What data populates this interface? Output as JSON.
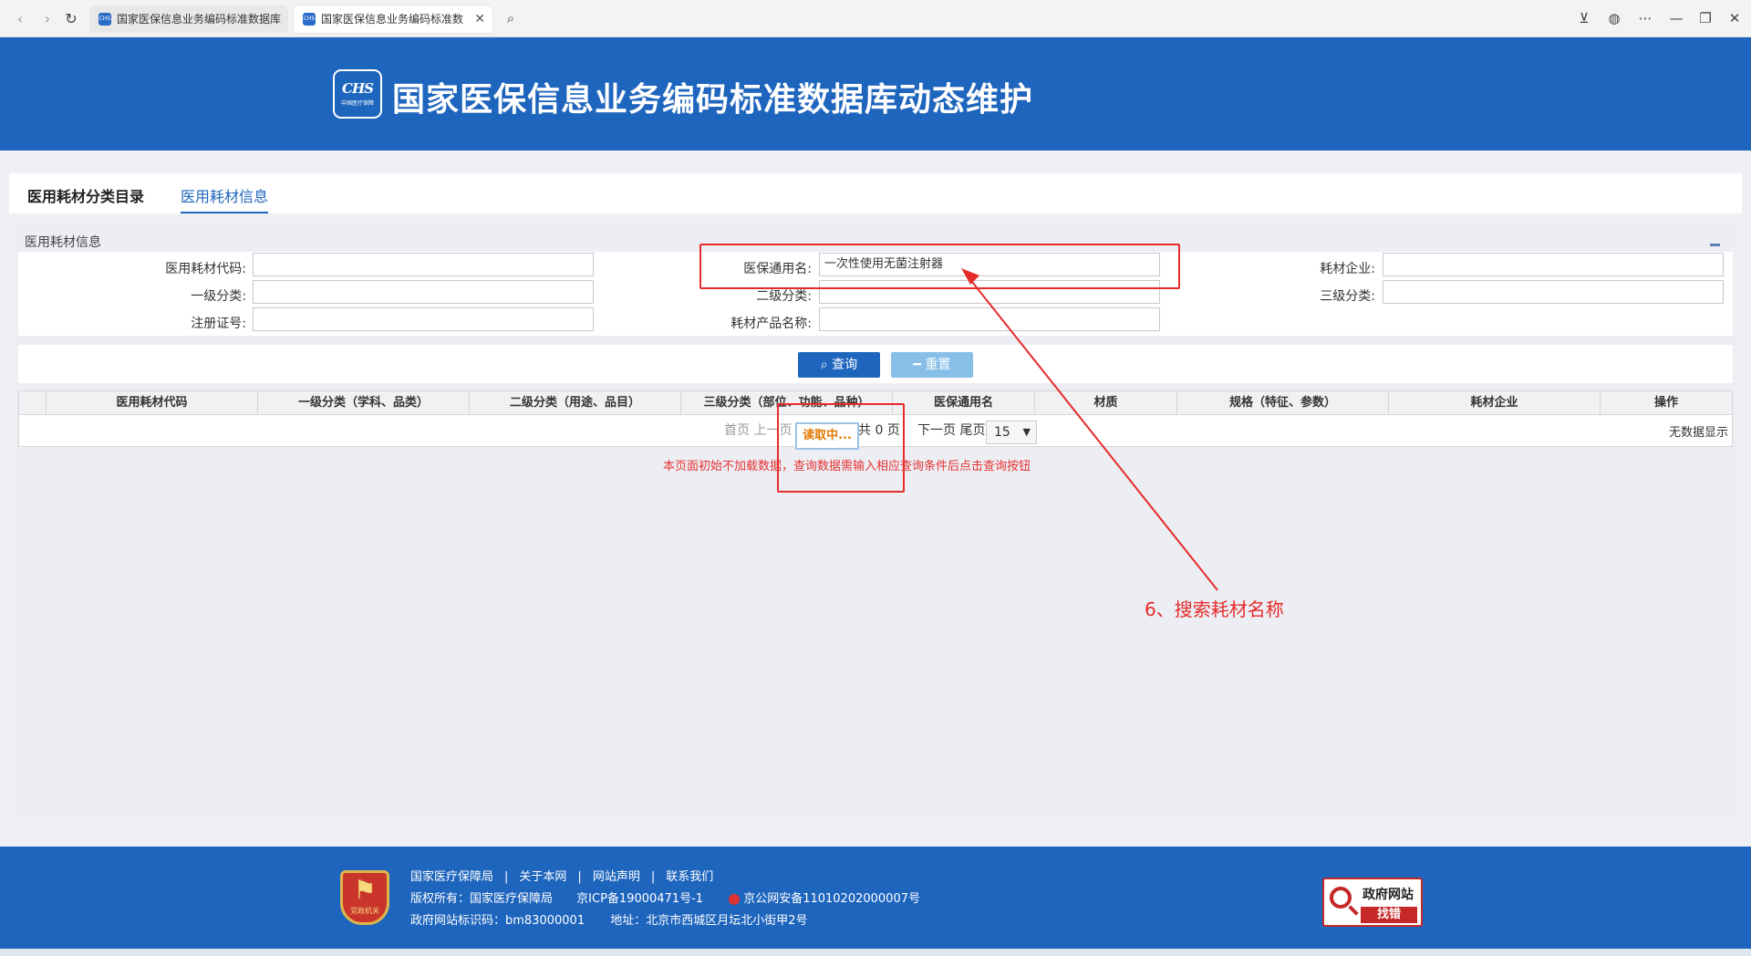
{
  "browser": {
    "tabs": [
      {
        "label": "国家医保信息业务编码标准数据库",
        "favicon": "CHS"
      },
      {
        "label": "国家医保信息业务编码标准数",
        "favicon": "CHS"
      }
    ]
  },
  "header": {
    "logo_text": "CHS",
    "logo_sub": "中国医疗保障",
    "title": "国家医保信息业务编码标准数据库动态维护"
  },
  "page_tabs": [
    {
      "label": "医用耗材分类目录",
      "active": false
    },
    {
      "label": "医用耗材信息",
      "active": true
    }
  ],
  "panel": {
    "title": "医用耗材信息"
  },
  "form": {
    "fields": [
      {
        "label": "医用耗材代码:",
        "value": ""
      },
      {
        "label": "医保通用名:",
        "value": "一次性使用无菌注射器"
      },
      {
        "label": "耗材企业:",
        "value": ""
      },
      {
        "label": "一级分类:",
        "value": ""
      },
      {
        "label": "二级分类:",
        "value": ""
      },
      {
        "label": "三级分类:",
        "value": ""
      },
      {
        "label": "注册证号:",
        "value": ""
      },
      {
        "label": "耗材产品名称:",
        "value": ""
      }
    ]
  },
  "buttons": {
    "query": "查询",
    "reset": "重置"
  },
  "grid": {
    "columns": [
      "医用耗材代码",
      "一级分类（学科、品类）",
      "二级分类（用途、品目）",
      "三级分类（部位、功能、品种）",
      "医保通用名",
      "材质",
      "规格（特征、参数）",
      "耗材企业",
      "操作"
    ],
    "pager": {
      "first": "首页",
      "prev": "上一页",
      "total": "共 0 页",
      "next": "下一页",
      "last": "尾页",
      "page_size": "15"
    },
    "no_data": "无数据显示",
    "loading": "读取中..."
  },
  "hint": "本页面初始不加载数据，查询数据需输入相应查询条件后点击查询按钮",
  "annotation": {
    "label": "6、搜索耗材名称",
    "color": "#e62b2b"
  },
  "footer": {
    "emblem_label": "党政机关",
    "links": [
      "国家医疗保障局",
      "关于本网",
      "网站声明",
      "联系我们"
    ],
    "copyright": "版权所有：国家医疗保障局",
    "icp": "京ICP备19000471号-1",
    "police": "京公网安备11010202000007号",
    "site_code": "政府网站标识码：bm83000001",
    "address": "地址：北京市西城区月坛北小街甲2号",
    "gov_btn_top": "政府网站",
    "gov_btn_bottom": "找错"
  },
  "colors": {
    "brand": "#1e65bd",
    "reset": "#87bfe8",
    "hint": "#e53333",
    "loading": "#e07b00"
  }
}
